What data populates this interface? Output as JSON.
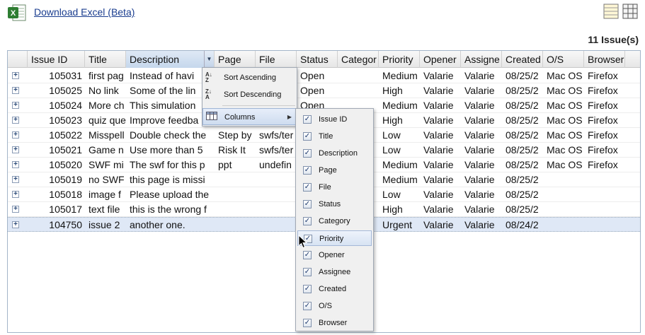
{
  "toolbar": {
    "download_label": "Download Excel (Beta)",
    "issue_count": "11 Issue(s)"
  },
  "grid": {
    "columns": [
      {
        "label": "Issue ID"
      },
      {
        "label": "Title"
      },
      {
        "label": "Description"
      },
      {
        "label": "Page"
      },
      {
        "label": "File"
      },
      {
        "label": "Status"
      },
      {
        "label": "Categor"
      },
      {
        "label": "Priority"
      },
      {
        "label": "Opener"
      },
      {
        "label": "Assigne"
      },
      {
        "label": "Created"
      },
      {
        "label": "O/S"
      },
      {
        "label": "Browser"
      }
    ],
    "rows": [
      {
        "id": "105031",
        "title": "first pag",
        "desc": "Instead of havi",
        "page": "",
        "file": "",
        "status": "Open",
        "category": "",
        "priority": "Medium",
        "opener": "Valarie",
        "assignee": "Valarie",
        "created": "08/25/2",
        "os": "Mac OS",
        "browser": "Firefox"
      },
      {
        "id": "105025",
        "title": "No link",
        "desc": "Some of the lin",
        "page": "",
        "file": "",
        "status": "Open",
        "category": "",
        "priority": "High",
        "opener": "Valarie",
        "assignee": "Valarie",
        "created": "08/25/2",
        "os": "Mac OS",
        "browser": "Firefox"
      },
      {
        "id": "105024",
        "title": "More ch",
        "desc": "This simulation",
        "page": "",
        "file": "",
        "status": "Open",
        "category": "",
        "priority": "Medium",
        "opener": "Valarie",
        "assignee": "Valarie",
        "created": "08/25/2",
        "os": "Mac OS",
        "browser": "Firefox"
      },
      {
        "id": "105023",
        "title": "quiz que",
        "desc": "Improve feedba",
        "page": "",
        "file": "",
        "status": "",
        "category": "",
        "priority": "High",
        "opener": "Valarie",
        "assignee": "Valarie",
        "created": "08/25/2",
        "os": "Mac OS",
        "browser": "Firefox"
      },
      {
        "id": "105022",
        "title": "Misspell",
        "desc": "Double check the",
        "page": "Step by",
        "file": "swfs/ter",
        "status": "",
        "category": "",
        "priority": "Low",
        "opener": "Valarie",
        "assignee": "Valarie",
        "created": "08/25/2",
        "os": "Mac OS",
        "browser": "Firefox"
      },
      {
        "id": "105021",
        "title": "Game n",
        "desc": "Use more than 5",
        "page": "Risk It",
        "file": "swfs/ter",
        "status": "",
        "category": "",
        "priority": "Low",
        "opener": "Valarie",
        "assignee": "Valarie",
        "created": "08/25/2",
        "os": "Mac OS",
        "browser": "Firefox"
      },
      {
        "id": "105020",
        "title": "SWF mi",
        "desc": "The swf for this p",
        "page": "ppt",
        "file": "undefin",
        "status": "",
        "category": "",
        "priority": "Medium",
        "opener": "Valarie",
        "assignee": "Valarie",
        "created": "08/25/2",
        "os": "Mac OS",
        "browser": "Firefox"
      },
      {
        "id": "105019",
        "title": "no SWF",
        "desc": "this page is missi",
        "page": "",
        "file": "",
        "status": "",
        "category": "",
        "priority": "Medium",
        "opener": "Valarie",
        "assignee": "Valarie",
        "created": "08/25/2",
        "os": "",
        "browser": ""
      },
      {
        "id": "105018",
        "title": "image f",
        "desc": "Please upload the",
        "page": "",
        "file": "",
        "status": "",
        "category": "",
        "priority": "Low",
        "opener": "Valarie",
        "assignee": "Valarie",
        "created": "08/25/2",
        "os": "",
        "browser": ""
      },
      {
        "id": "105017",
        "title": "text file",
        "desc": "this is the wrong f",
        "page": "",
        "file": "",
        "status": "",
        "category": "",
        "priority": "High",
        "opener": "Valarie",
        "assignee": "Valarie",
        "created": "08/25/2",
        "os": "",
        "browser": ""
      },
      {
        "id": "104750",
        "title": "issue 2",
        "desc": "another one.",
        "page": "",
        "file": "",
        "status": "",
        "category": "",
        "priority": "Urgent",
        "opener": "Valarie",
        "assignee": "Valarie",
        "created": "08/24/2",
        "os": "",
        "browser": ""
      }
    ]
  },
  "column_menu": {
    "sort_asc": "Sort Ascending",
    "sort_desc": "Sort Descending",
    "columns": "Columns",
    "items": [
      {
        "label": "Issue ID",
        "checked": true
      },
      {
        "label": "Title",
        "checked": true
      },
      {
        "label": "Description",
        "checked": true
      },
      {
        "label": "Page",
        "checked": true
      },
      {
        "label": "File",
        "checked": true
      },
      {
        "label": "Status",
        "checked": true
      },
      {
        "label": "Category",
        "checked": true
      },
      {
        "label": "Priority",
        "checked": true
      },
      {
        "label": "Opener",
        "checked": true
      },
      {
        "label": "Assignee",
        "checked": true
      },
      {
        "label": "Created",
        "checked": true
      },
      {
        "label": "O/S",
        "checked": true
      },
      {
        "label": "Browser",
        "checked": true
      }
    ]
  },
  "icons": {
    "excel": "excel-icon",
    "list_view": "list-view-icon",
    "grid_view": "grid-view-icon"
  },
  "colors": {
    "link": "#1a3d8f",
    "grid_border": "#a3b5c9",
    "selected_row": "#dfe8f6",
    "excel_green": "#2e7d32"
  }
}
